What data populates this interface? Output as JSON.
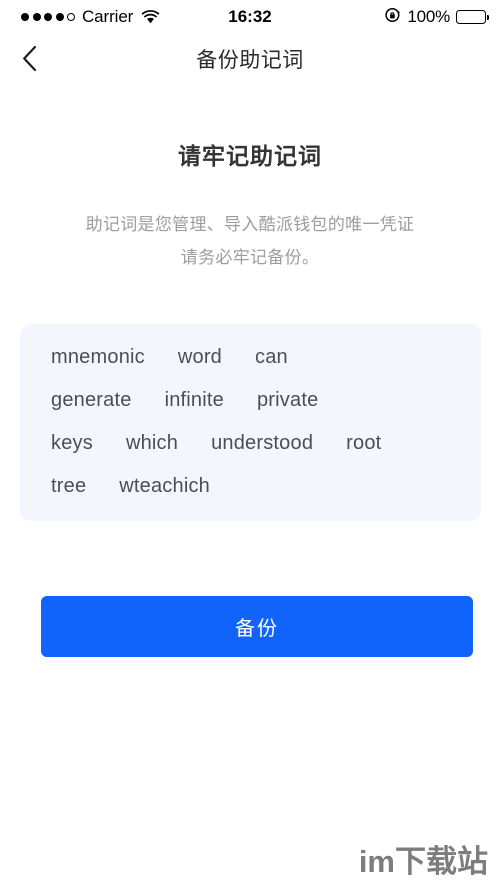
{
  "status_bar": {
    "signal_dots_filled": 4,
    "signal_dots_total": 5,
    "carrier": "Carrier",
    "wifi_icon": "wifi-icon",
    "time": "16:32",
    "rotation_lock_icon": "rotation-lock-icon",
    "battery_percent": "100%",
    "battery_icon": "battery-icon"
  },
  "nav_bar": {
    "back_icon": "chevron-left-icon",
    "title": "备份助记词"
  },
  "content": {
    "heading": "请牢记助记词",
    "subtitle_line_1": "助记词是您管理、导入酷派钱包的唯一凭证",
    "subtitle_line_2": "请务必牢记备份。"
  },
  "mnemonic": {
    "rows": [
      [
        "mnemonic",
        "word",
        "can"
      ],
      [
        "generate",
        "infinite",
        "private"
      ],
      [
        "keys",
        "which",
        "understood",
        "root"
      ],
      [
        "tree",
        "wteachich"
      ]
    ],
    "words": [
      "mnemonic",
      "word",
      "can",
      "generate",
      "infinite",
      "private",
      "keys",
      "which",
      "understood",
      "root",
      "tree",
      "wteachich"
    ]
  },
  "actions": {
    "backup_label": "备份"
  },
  "watermark": {
    "text": "im下载站"
  },
  "colors": {
    "primary": "#1063fb",
    "card_background": "#f4f6fd",
    "word_text": "#4d4d57",
    "subtitle_text": "#9c9ca3",
    "heading_text": "#333338",
    "watermark_text": "#7d7d7d"
  }
}
